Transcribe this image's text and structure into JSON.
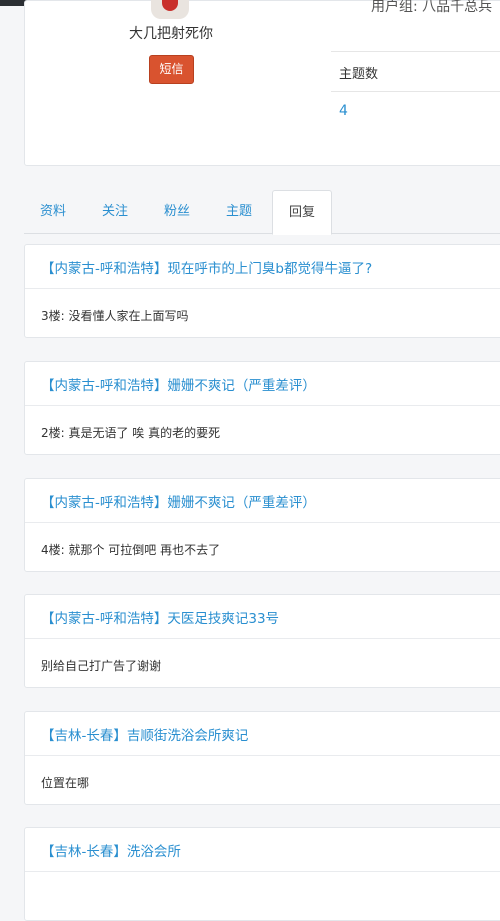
{
  "profile": {
    "username": "大几把射死你",
    "sms_button": "短信",
    "usergroup": "用户组: 八品千总兵",
    "stat_label": "主题数",
    "stat_value": "4"
  },
  "tabs": [
    {
      "label": "资料"
    },
    {
      "label": "关注"
    },
    {
      "label": "粉丝"
    },
    {
      "label": "主题"
    },
    {
      "label": "回复",
      "active": true
    }
  ],
  "posts": [
    {
      "title": "【内蒙古-呼和浩特】现在呼市的上门臭b都觉得牛逼了?",
      "reply": "3楼: 没看懂人家在上面写吗"
    },
    {
      "title": "【内蒙古-呼和浩特】姗姗不爽记（严重差评）",
      "reply": "2楼: 真是无语了 唉 真的老的要死"
    },
    {
      "title": "【内蒙古-呼和浩特】姗姗不爽记（严重差评）",
      "reply": "4楼: 就那个 可拉倒吧 再也不去了"
    },
    {
      "title": "【内蒙古-呼和浩特】天医足技爽记33号",
      "reply": "别给自己打广告了谢谢"
    },
    {
      "title": "【吉林-长春】吉顺街洗浴会所爽记",
      "reply": "位置在哪"
    },
    {
      "title": "【吉林-长春】洗浴会所",
      "reply": ""
    }
  ]
}
